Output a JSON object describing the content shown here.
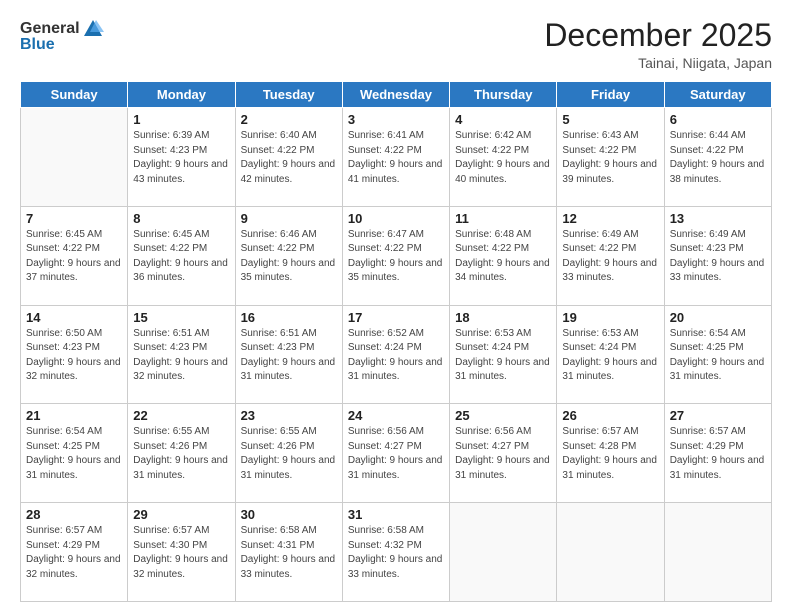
{
  "header": {
    "logo_general": "General",
    "logo_blue": "Blue",
    "title": "December 2025",
    "location": "Tainai, Niigata, Japan"
  },
  "weekdays": [
    "Sunday",
    "Monday",
    "Tuesday",
    "Wednesday",
    "Thursday",
    "Friday",
    "Saturday"
  ],
  "weeks": [
    [
      {
        "day": "",
        "sunrise": "",
        "sunset": "",
        "daylight": ""
      },
      {
        "day": "1",
        "sunrise": "6:39 AM",
        "sunset": "4:23 PM",
        "daylight": "9 hours and 43 minutes."
      },
      {
        "day": "2",
        "sunrise": "6:40 AM",
        "sunset": "4:22 PM",
        "daylight": "9 hours and 42 minutes."
      },
      {
        "day": "3",
        "sunrise": "6:41 AM",
        "sunset": "4:22 PM",
        "daylight": "9 hours and 41 minutes."
      },
      {
        "day": "4",
        "sunrise": "6:42 AM",
        "sunset": "4:22 PM",
        "daylight": "9 hours and 40 minutes."
      },
      {
        "day": "5",
        "sunrise": "6:43 AM",
        "sunset": "4:22 PM",
        "daylight": "9 hours and 39 minutes."
      },
      {
        "day": "6",
        "sunrise": "6:44 AM",
        "sunset": "4:22 PM",
        "daylight": "9 hours and 38 minutes."
      }
    ],
    [
      {
        "day": "7",
        "sunrise": "6:45 AM",
        "sunset": "4:22 PM",
        "daylight": "9 hours and 37 minutes."
      },
      {
        "day": "8",
        "sunrise": "6:45 AM",
        "sunset": "4:22 PM",
        "daylight": "9 hours and 36 minutes."
      },
      {
        "day": "9",
        "sunrise": "6:46 AM",
        "sunset": "4:22 PM",
        "daylight": "9 hours and 35 minutes."
      },
      {
        "day": "10",
        "sunrise": "6:47 AM",
        "sunset": "4:22 PM",
        "daylight": "9 hours and 35 minutes."
      },
      {
        "day": "11",
        "sunrise": "6:48 AM",
        "sunset": "4:22 PM",
        "daylight": "9 hours and 34 minutes."
      },
      {
        "day": "12",
        "sunrise": "6:49 AM",
        "sunset": "4:22 PM",
        "daylight": "9 hours and 33 minutes."
      },
      {
        "day": "13",
        "sunrise": "6:49 AM",
        "sunset": "4:23 PM",
        "daylight": "9 hours and 33 minutes."
      }
    ],
    [
      {
        "day": "14",
        "sunrise": "6:50 AM",
        "sunset": "4:23 PM",
        "daylight": "9 hours and 32 minutes."
      },
      {
        "day": "15",
        "sunrise": "6:51 AM",
        "sunset": "4:23 PM",
        "daylight": "9 hours and 32 minutes."
      },
      {
        "day": "16",
        "sunrise": "6:51 AM",
        "sunset": "4:23 PM",
        "daylight": "9 hours and 31 minutes."
      },
      {
        "day": "17",
        "sunrise": "6:52 AM",
        "sunset": "4:24 PM",
        "daylight": "9 hours and 31 minutes."
      },
      {
        "day": "18",
        "sunrise": "6:53 AM",
        "sunset": "4:24 PM",
        "daylight": "9 hours and 31 minutes."
      },
      {
        "day": "19",
        "sunrise": "6:53 AM",
        "sunset": "4:24 PM",
        "daylight": "9 hours and 31 minutes."
      },
      {
        "day": "20",
        "sunrise": "6:54 AM",
        "sunset": "4:25 PM",
        "daylight": "9 hours and 31 minutes."
      }
    ],
    [
      {
        "day": "21",
        "sunrise": "6:54 AM",
        "sunset": "4:25 PM",
        "daylight": "9 hours and 31 minutes."
      },
      {
        "day": "22",
        "sunrise": "6:55 AM",
        "sunset": "4:26 PM",
        "daylight": "9 hours and 31 minutes."
      },
      {
        "day": "23",
        "sunrise": "6:55 AM",
        "sunset": "4:26 PM",
        "daylight": "9 hours and 31 minutes."
      },
      {
        "day": "24",
        "sunrise": "6:56 AM",
        "sunset": "4:27 PM",
        "daylight": "9 hours and 31 minutes."
      },
      {
        "day": "25",
        "sunrise": "6:56 AM",
        "sunset": "4:27 PM",
        "daylight": "9 hours and 31 minutes."
      },
      {
        "day": "26",
        "sunrise": "6:57 AM",
        "sunset": "4:28 PM",
        "daylight": "9 hours and 31 minutes."
      },
      {
        "day": "27",
        "sunrise": "6:57 AM",
        "sunset": "4:29 PM",
        "daylight": "9 hours and 31 minutes."
      }
    ],
    [
      {
        "day": "28",
        "sunrise": "6:57 AM",
        "sunset": "4:29 PM",
        "daylight": "9 hours and 32 minutes."
      },
      {
        "day": "29",
        "sunrise": "6:57 AM",
        "sunset": "4:30 PM",
        "daylight": "9 hours and 32 minutes."
      },
      {
        "day": "30",
        "sunrise": "6:58 AM",
        "sunset": "4:31 PM",
        "daylight": "9 hours and 33 minutes."
      },
      {
        "day": "31",
        "sunrise": "6:58 AM",
        "sunset": "4:32 PM",
        "daylight": "9 hours and 33 minutes."
      },
      {
        "day": "",
        "sunrise": "",
        "sunset": "",
        "daylight": ""
      },
      {
        "day": "",
        "sunrise": "",
        "sunset": "",
        "daylight": ""
      },
      {
        "day": "",
        "sunrise": "",
        "sunset": "",
        "daylight": ""
      }
    ]
  ],
  "labels": {
    "sunrise": "Sunrise:",
    "sunset": "Sunset:",
    "daylight": "Daylight:"
  }
}
